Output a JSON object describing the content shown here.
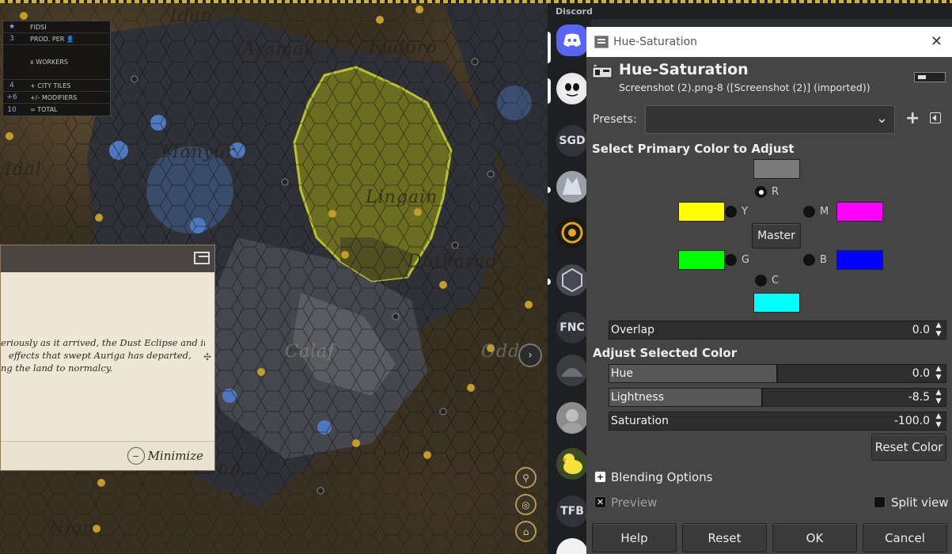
{
  "game": {
    "map_labels": [
      "Idan",
      "Aramak",
      "Fudoro",
      "Manyur",
      "Lingain",
      "Dutharad",
      "Calaf",
      "Odd",
      "Idal",
      "Luang",
      "Nion"
    ],
    "stats_panel": {
      "rows": [
        {
          "num": "★",
          "label": "FIDSI"
        },
        {
          "num": "3",
          "label": "PROD. PER 👤"
        },
        {
          "num": "",
          "label": "x WORKERS"
        },
        {
          "num": "4",
          "label": "+ CITY TILES"
        },
        {
          "num": "+6",
          "label": "+/- MODIFIERS"
        },
        {
          "num": "10",
          "label": "= TOTAL"
        }
      ]
    },
    "event_popup": {
      "lines": [
        "eriously as it arrived, the Dust Eclipse and its",
        "effects that swept Auriga has departed,",
        "ng the land to normalcy."
      ],
      "minimize_label": "Minimize"
    }
  },
  "discord": {
    "app_title": "Discord",
    "servers": [
      {
        "label": "",
        "icon": "discord-logo-icon"
      },
      {
        "label": "",
        "icon": "skull-avatar-icon"
      },
      {
        "label": "SGD",
        "icon": ""
      },
      {
        "label": "",
        "icon": "wolf-avatar-icon"
      },
      {
        "label": "",
        "icon": "golden-emblem-icon"
      },
      {
        "label": "",
        "icon": "hex-logo-icon"
      },
      {
        "label": "FNC",
        "icon": ""
      },
      {
        "label": "",
        "icon": "dark-avatar-icon"
      },
      {
        "label": "",
        "icon": "face-avatar-icon"
      },
      {
        "label": "",
        "icon": "duck-avatar-icon"
      },
      {
        "label": "TFB",
        "icon": ""
      }
    ]
  },
  "gimp": {
    "window_title": "Hue-Saturation",
    "tool_name": "Hue-Saturation",
    "subtitle": "Screenshot (2).png-8 ([Screenshot (2)] (imported))",
    "presets_label": "Presets:",
    "presets_value": "",
    "primary_section": "Select Primary Color to Adjust",
    "colors": {
      "R": {
        "label": "R",
        "swatch": "#7a7a7a",
        "selected": true
      },
      "Y": {
        "label": "Y",
        "swatch": "#ffff00"
      },
      "M": {
        "label": "M",
        "swatch": "#ff00ff"
      },
      "G": {
        "label": "G",
        "swatch": "#00ff00"
      },
      "B": {
        "label": "B",
        "swatch": "#0000ff"
      },
      "C": {
        "label": "C",
        "swatch": "#00ffff"
      }
    },
    "master_label": "Master",
    "overlap": {
      "label": "Overlap",
      "value": "0.0",
      "fraction": 0.0
    },
    "adjust_section": "Adjust Selected Color",
    "hue": {
      "label": "Hue",
      "value": "0.0",
      "fraction": 0.5
    },
    "lightness": {
      "label": "Lightness",
      "value": "-8.5",
      "fraction": 0.4575
    },
    "saturation": {
      "label": "Saturation",
      "value": "-100.0",
      "fraction": 0.0
    },
    "reset_color_label": "Reset Color",
    "blending_label": "Blending Options",
    "preview_label": "Preview",
    "preview_checked": true,
    "split_view_label": "Split view",
    "split_view_checked": false,
    "buttons": {
      "help": "Help",
      "reset": "Reset",
      "ok": "OK",
      "cancel": "Cancel"
    }
  }
}
